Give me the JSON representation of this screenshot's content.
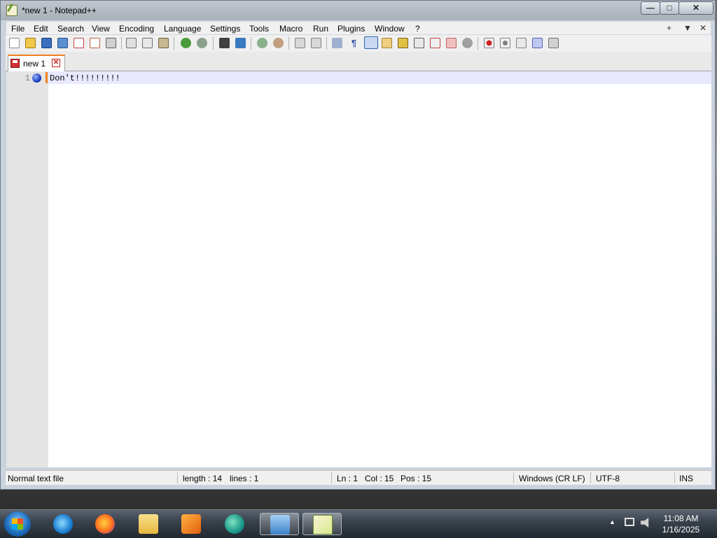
{
  "window": {
    "title": "*new 1 - Notepad++",
    "controls": {
      "minimize": "—",
      "maximize": "□",
      "close": "✕"
    }
  },
  "menu": {
    "items": [
      "File",
      "Edit",
      "Search",
      "View",
      "Encoding",
      "Language",
      "Settings",
      "Tools",
      "Macro",
      "Run",
      "Plugins",
      "Window",
      "?"
    ],
    "right_controls": [
      "+",
      "▼",
      "✕"
    ]
  },
  "toolbar": {
    "buttons": [
      "new-file",
      "open-file",
      "save",
      "save-all",
      "close",
      "close-all",
      "print",
      "cut",
      "copy",
      "paste",
      "undo",
      "redo",
      "find",
      "replace",
      "zoom-in",
      "zoom-out",
      "sync-vertical",
      "sync-horizontal",
      "word-wrap",
      "show-all-characters",
      "indent-guide",
      "function-list",
      "document-map",
      "folder-as-workspace",
      "monitoring",
      "macro-record",
      "macro-stop",
      "macro-play",
      "macro-run-multiple",
      "macro-save"
    ]
  },
  "tabs": [
    {
      "label": "new 1",
      "modified": true
    }
  ],
  "editor": {
    "lines": [
      {
        "number": "1",
        "text": "Don't!!!!!!!!!",
        "bookmarked": true
      }
    ]
  },
  "status": {
    "file_type": "Normal text file",
    "length": "length : 14",
    "lines": "lines : 1",
    "ln": "Ln : 1",
    "col": "Col : 15",
    "pos": "Pos : 15",
    "eol": "Windows (CR LF)",
    "encoding": "UTF-8",
    "mode": "INS"
  },
  "taskbar": {
    "apps": [
      "internet-explorer",
      "firefox",
      "file-explorer",
      "media-player",
      "edge",
      "control-panel",
      "notepad-plus-plus"
    ],
    "active_app": "notepad-plus-plus",
    "tray": {
      "show_hidden": "▲"
    },
    "clock": {
      "time": "11:08 AM",
      "date": "1/16/2025"
    }
  },
  "colors": {
    "tab_accent": "#f08020",
    "current_line": "#e8e8ff",
    "bookmark": "#2040c0"
  }
}
